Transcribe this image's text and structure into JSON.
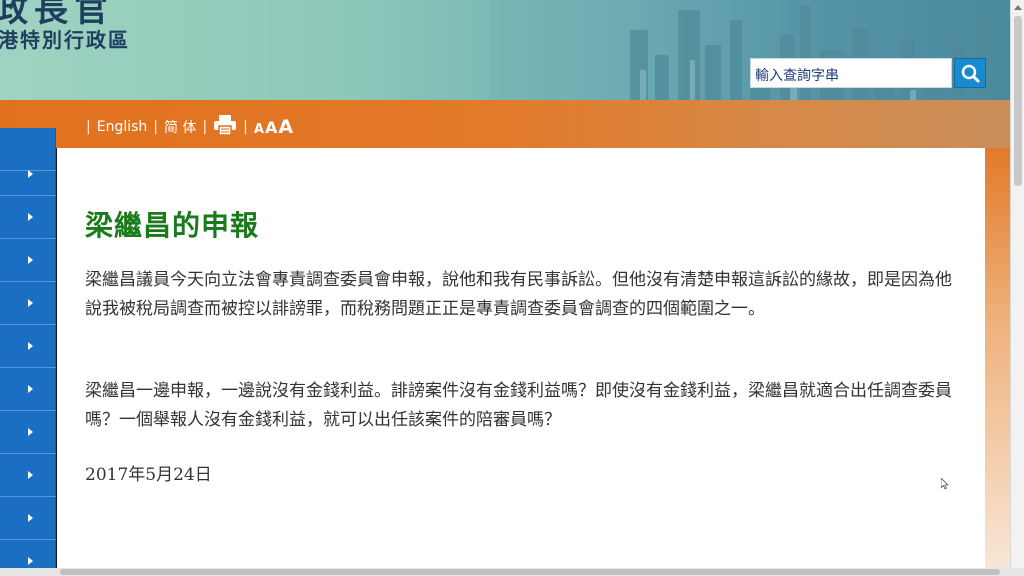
{
  "header": {
    "gov_title_line1": "政長官",
    "gov_title_line2": "港特別行政區",
    "search_placeholder": "輸入查詢字串"
  },
  "nav": {
    "english": "English",
    "simplified": "简 体",
    "aaa_small": "A",
    "aaa_medium": "A",
    "aaa_large": "A"
  },
  "sidebar": {
    "items": [
      "",
      "",
      "",
      "",
      "",
      "",
      "",
      "",
      "",
      ""
    ]
  },
  "article": {
    "title": "梁繼昌的申報",
    "paragraph1": "梁繼昌議員今天向立法會專責調查委員會申報，說他和我有民事訴訟。但他沒有清楚申報這訴訟的緣故，即是因為他說我被稅局調查而被控以誹謗罪，而稅務問題正正是專責調查委員會調查的四個範圍之一。",
    "paragraph2": "梁繼昌一邊申報，一邊說沒有金錢利益。誹謗案件沒有金錢利益嗎？即使沒有金錢利益，梁繼昌就適合出任調查委員嗎？一個舉報人沒有金錢利益，就可以出任該案件的陪審員嗎？",
    "date": "2017年5月24日"
  },
  "colors": {
    "nav_orange": "#e2711d",
    "sidebar_blue": "#1a6fc2",
    "title_green": "#1b7a1b",
    "search_button": "#1a8ad0"
  },
  "icons": [
    "search-icon",
    "print-icon",
    "chevron-right-icon",
    "mouse-cursor-icon"
  ]
}
